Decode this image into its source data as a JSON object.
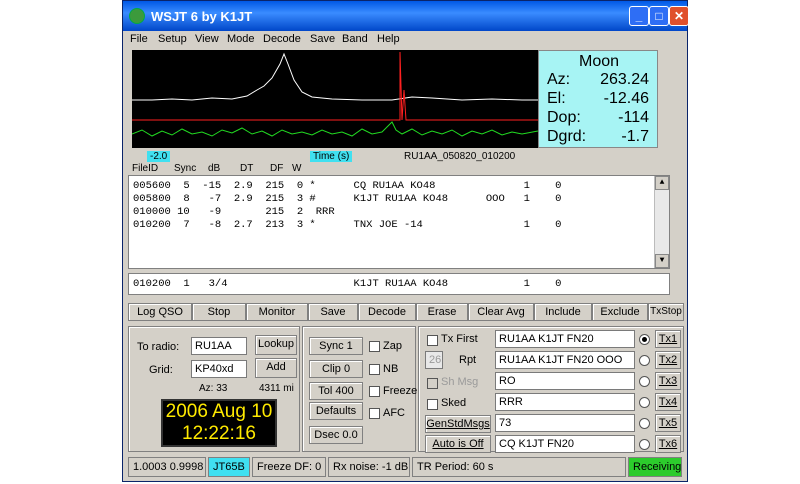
{
  "window": {
    "title": "WSJT 6     by K1JT",
    "controls": [
      "_",
      "□",
      "✕"
    ]
  },
  "menu": [
    "File",
    "Setup",
    "View",
    "Mode",
    "Decode",
    "Save",
    "Band",
    "Help"
  ],
  "moon": {
    "title": "Moon",
    "rows": [
      {
        "label": "Az:",
        "value": "263.24"
      },
      {
        "label": "El:",
        "value": "-12.46"
      },
      {
        "label": "Dop:",
        "value": "-114"
      },
      {
        "label": "Dgrd:",
        "value": "-1.7"
      }
    ]
  },
  "scale": {
    "left_value": "-2.0",
    "time_label": "Time (s)",
    "file_name": "RU1AA_050820_010200"
  },
  "decode_headers": [
    "FileID",
    "Sync",
    "dB",
    "DT",
    "DF",
    "W"
  ],
  "decoded_lines": [
    "005600  5  -15  2.9  215  0 *      CQ RU1AA KO48              1    0",
    "005800  8   -7  2.9  215  3 #      K1JT RU1AA KO48      OOO   1    0",
    "010000 10   -9       215  2  RRR",
    "010200  7   -8  2.7  213  3 *      TNX JOE -14                1    0"
  ],
  "average_line": "010200  1   3/4                    K1JT RU1AA KO48            1    0",
  "buttons": [
    "Log QSO",
    "Stop",
    "Monitor",
    "Save",
    "Decode",
    "Erase",
    "Clear Avg",
    "Include",
    "Exclude",
    "TxStop"
  ],
  "station": {
    "to_radio_label": "To radio:",
    "to_radio_value": "RU1AA",
    "grid_label": "Grid:",
    "grid_value": "KP40xd",
    "lookup_label": "Lookup",
    "add_label": "Add",
    "az": "Az: 33",
    "distance": "4311 mi",
    "date": "2006 Aug 10",
    "time": "12:22:16"
  },
  "params": {
    "sync": "Sync  1",
    "clip": "Clip  0",
    "tol": "Tol  400",
    "defaults": "Defaults",
    "dsec": "Dsec  0.0",
    "zap": "Zap",
    "nb": "NB",
    "freeze": "Freeze",
    "afc": "AFC"
  },
  "tx": {
    "tx_first": "Tx First",
    "rpt_value": "26",
    "rpt_label": "Rpt",
    "sh_msg": "Sh Msg",
    "sked": "Sked",
    "gen_std": "GenStdMsgs",
    "auto": "Auto is Off",
    "messages": [
      "RU1AA K1JT FN20",
      "RU1AA K1JT FN20 OOO",
      "RO",
      "RRR",
      "73",
      "CQ K1JT FN20"
    ],
    "tx_buttons": [
      "Tx1",
      "Tx2",
      "Tx3",
      "Tx4",
      "Tx5",
      "Tx6"
    ]
  },
  "status": {
    "ratio": "1.0003 0.9998",
    "mode": "JT65B",
    "freeze_df": "Freeze DF:  0",
    "rx_noise": "Rx noise: -1 dB",
    "tr_period": "TR Period: 60 s",
    "state": "Receiving"
  },
  "colors": {
    "moon_bg": "#a7f4f4",
    "mode_bg": "#40e0f0",
    "receiving_bg": "#2ccb2c",
    "clock_text": "#ffea00"
  }
}
